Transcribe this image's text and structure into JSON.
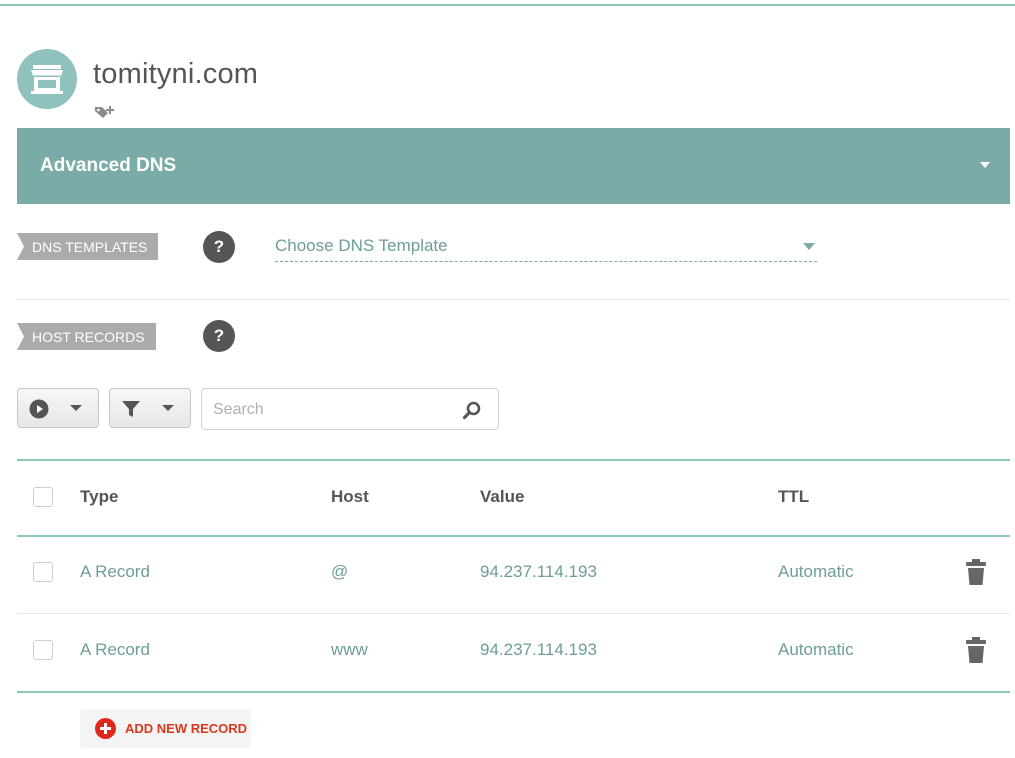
{
  "domain": {
    "name": "tomityni.com",
    "avatar_icon": "storefront-icon",
    "tag_icon": "add-tag-icon"
  },
  "section": {
    "title": "Advanced DNS"
  },
  "dns_templates": {
    "label": "DNS TEMPLATES",
    "help": "?",
    "select_value": "Choose DNS Template"
  },
  "host_records": {
    "label": "HOST RECORDS",
    "help": "?"
  },
  "toolbar": {
    "actions_icon": "play-circle-icon",
    "filter_icon": "filter-funnel-icon",
    "search_placeholder": "Search",
    "search_icon": "magnifier-icon"
  },
  "table": {
    "headers": {
      "type": "Type",
      "host": "Host",
      "value": "Value",
      "ttl": "TTL"
    },
    "rows": [
      {
        "type": "A Record",
        "host": "@",
        "value": "94.237.114.193",
        "ttl": "Automatic"
      },
      {
        "type": "A Record",
        "host": "www",
        "value": "94.237.114.193",
        "ttl": "Automatic"
      }
    ]
  },
  "add_record": {
    "label": "ADD NEW RECORD"
  },
  "colors": {
    "accent": "#7aaba7",
    "accent_light": "#8fc5bd",
    "danger": "#e0271e",
    "text_muted": "#6d9d99"
  }
}
